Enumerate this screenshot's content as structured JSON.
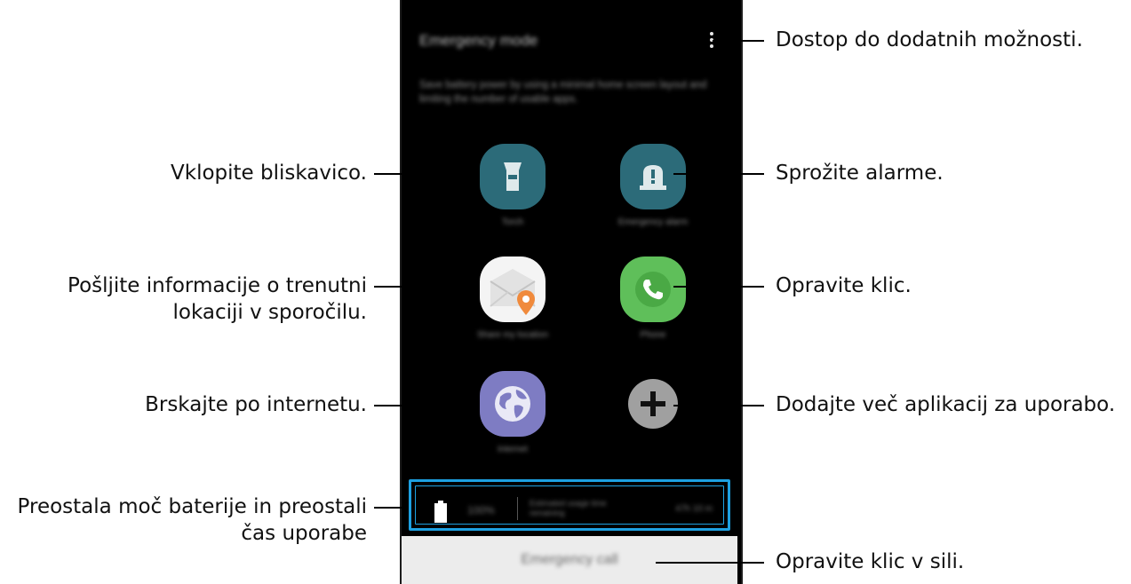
{
  "screen": {
    "title": "Emergency mode",
    "description": "Save battery power by using a minimal home screen layout and limiting the number of usable apps.",
    "apps": [
      {
        "name": "torch",
        "label": "Torch",
        "icon": "flashlight-icon",
        "color": "#2c6b79"
      },
      {
        "name": "emergency-alarm",
        "label": "Emergency alarm",
        "icon": "alarm-icon",
        "color": "#2c6b79"
      },
      {
        "name": "share-my-location",
        "label": "Share my location",
        "icon": "envelope-location-icon",
        "color": "#f4f4f4"
      },
      {
        "name": "phone",
        "label": "Phone",
        "icon": "phone-icon",
        "color": "#5fbf5a"
      },
      {
        "name": "internet",
        "label": "Internet",
        "icon": "globe-icon",
        "color": "#7e7cc3"
      },
      {
        "name": "add-app",
        "label": "",
        "icon": "plus-icon",
        "color": "#a0a0a0"
      }
    ],
    "battery": {
      "percent": "100%",
      "estimate_label": "Estimated usage time remaining",
      "time": "47h 10 m"
    },
    "emergency_call_label": "Emergency call",
    "accent": "#1da1e2"
  },
  "callouts": {
    "more_options": "Dostop do dodatnih možnosti.",
    "torch": "Vklopite bliskavico.",
    "alarm": "Sprožite alarme.",
    "location_line1": "Pošljite informacije o trenutni",
    "location_line2": "lokaciji v sporočilu.",
    "phone": "Opravite klic.",
    "internet": "Brskajte po internetu.",
    "add_apps": "Dodajte več aplikacij za uporabo.",
    "battery_line1": "Preostala moč baterije in preostali",
    "battery_line2": "čas uporabe",
    "emergency_call": "Opravite klic v sili."
  }
}
